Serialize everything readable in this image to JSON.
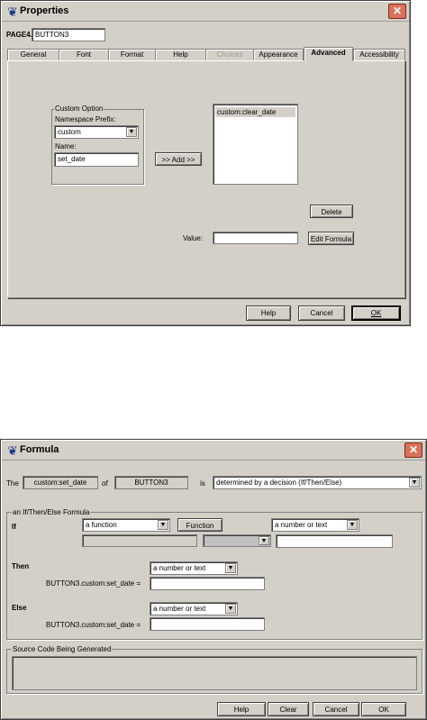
{
  "properties": {
    "title": "Properties",
    "page_label": "PAGE4.",
    "item_name": "BUTTON3",
    "tabs": [
      {
        "label": "General"
      },
      {
        "label": "Font"
      },
      {
        "label": "Format"
      },
      {
        "label": "Help"
      },
      {
        "label": "Choices"
      },
      {
        "label": "Appearance"
      },
      {
        "label": "Advanced"
      },
      {
        "label": "Accessibility"
      }
    ],
    "custom_option": {
      "caption": "Custom Option",
      "namespace_label": "Namespace Prefix:",
      "namespace_value": "custom",
      "name_label": "Name:",
      "name_value": "set_date"
    },
    "add_button": ">> Add >>",
    "list_items": [
      "custom:clear_date"
    ],
    "delete_button": "Delete",
    "value_label": "Value:",
    "value_input": "",
    "edit_formula_button": "Edit Formula",
    "help_button": "Help",
    "cancel_button": "Cancel",
    "ok_button": "OK"
  },
  "formula": {
    "title": "Formula",
    "the_label": "The",
    "option_name": "custom:set_date",
    "of_label": "of",
    "item_name": "BUTTON3",
    "is_label": "is",
    "decision_select": "determined by a decision (If/Then/Else)",
    "group_caption": "an If/Then/Else Formula",
    "if_label": "If",
    "if_select_left": "a function",
    "function_button": "Function",
    "if_select_right": "a number or text",
    "then_label": "Then",
    "then_select": "a number or text",
    "then_expr_label": "BUTTON3.custom:set_date =",
    "else_label": "Else",
    "else_select": "a number or text",
    "else_expr_label": "BUTTON3.custom:set_date =",
    "source_caption": "Source Code Being Generated",
    "help_button": "Help",
    "clear_button": "Clear",
    "cancel_button": "Cancel",
    "ok_button": "OK"
  },
  "colors": {
    "dialog_face": "#d4d0c8",
    "close_button": "#d9725a",
    "title_icon": "#1a3d8a"
  },
  "icons": {
    "title_icon": "app-logo-icon",
    "close": "close-icon",
    "dropdown": "chevron-down-icon"
  }
}
